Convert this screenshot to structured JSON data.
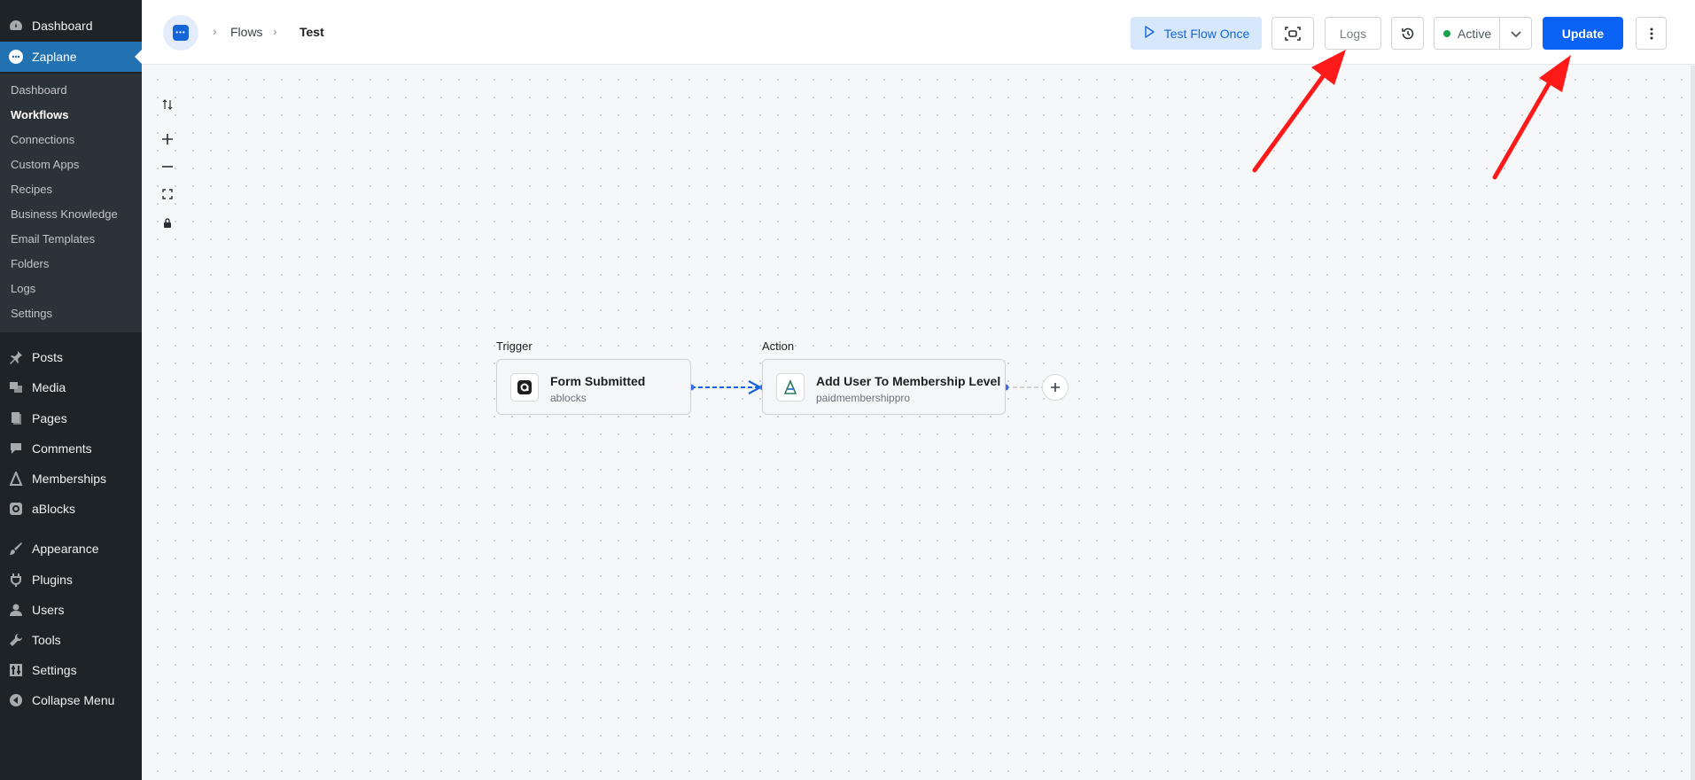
{
  "sidebar": {
    "top_items": [
      {
        "label": "Dashboard",
        "icon": "dashboard-icon"
      },
      {
        "label": "Zaplane",
        "icon": "zaplane-icon",
        "active": true
      }
    ],
    "submenu": [
      "Dashboard",
      "Workflows",
      "Connections",
      "Custom Apps",
      "Recipes",
      "Business Knowledge",
      "Email Templates",
      "Folders",
      "Logs",
      "Settings"
    ],
    "current_submenu": "Workflows",
    "menu": [
      {
        "label": "Posts",
        "icon": "pin-icon"
      },
      {
        "label": "Media",
        "icon": "media-icon"
      },
      {
        "label": "Pages",
        "icon": "pages-icon"
      },
      {
        "label": "Comments",
        "icon": "comment-icon"
      },
      {
        "label": "Memberships",
        "icon": "membership-icon"
      },
      {
        "label": "aBlocks",
        "icon": "ablocks-icon"
      },
      {
        "label": "Appearance",
        "icon": "brush-icon"
      },
      {
        "label": "Plugins",
        "icon": "plugin-icon"
      },
      {
        "label": "Users",
        "icon": "user-icon"
      },
      {
        "label": "Tools",
        "icon": "wrench-icon"
      },
      {
        "label": "Settings",
        "icon": "settings-icon"
      },
      {
        "label": "Collapse Menu",
        "icon": "collapse-icon"
      }
    ]
  },
  "header": {
    "breadcrumb": [
      "Flows",
      "Test"
    ],
    "test_flow_label": "Test Flow Once",
    "logs_label": "Logs",
    "status_label": "Active",
    "update_label": "Update"
  },
  "flow": {
    "trigger": {
      "section_label": "Trigger",
      "title": "Form Submitted",
      "app": "ablocks"
    },
    "action": {
      "section_label": "Action",
      "title": "Add User To Membership Level",
      "app": "paidmembershippro"
    }
  },
  "colors": {
    "sidebar_bg": "#1d2327",
    "active_blue": "#2271b1",
    "primary": "#0b63f6",
    "status_green": "#16a34a",
    "annotation_arrow": "#ff1a1a"
  }
}
